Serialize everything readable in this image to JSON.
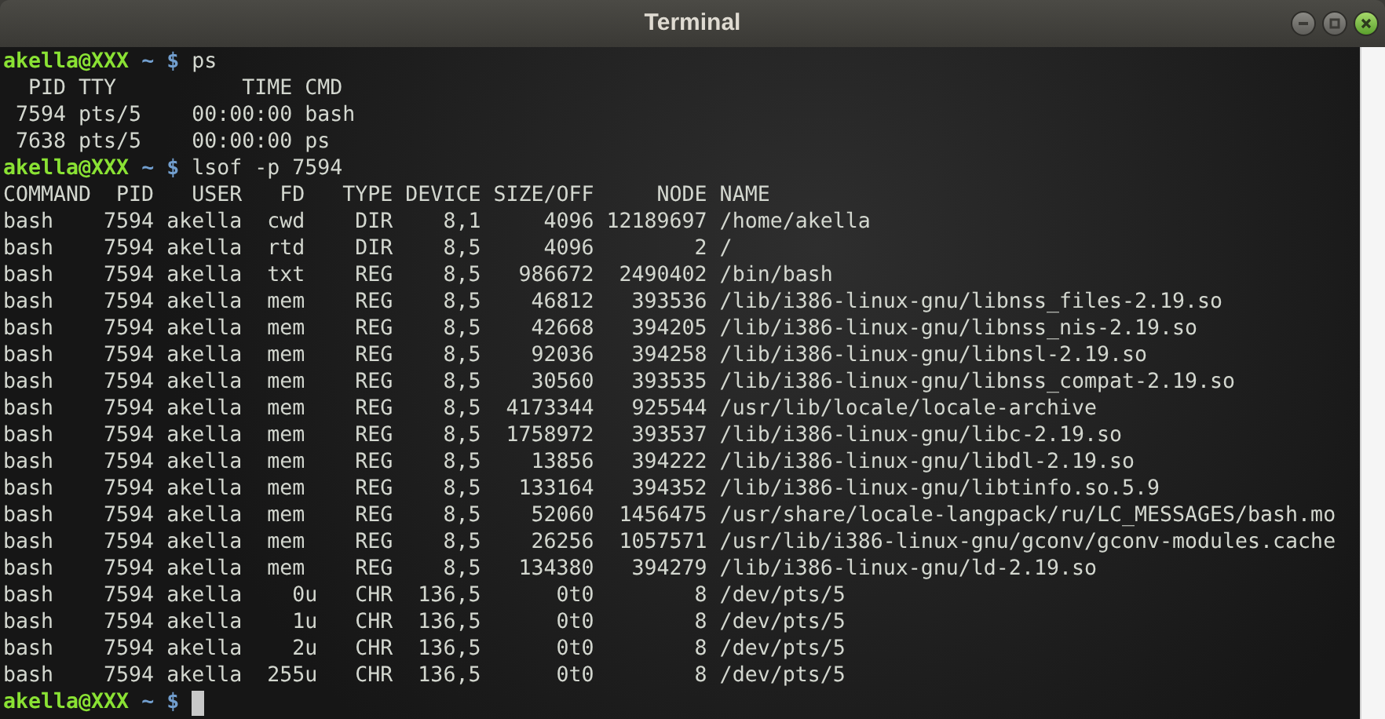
{
  "window": {
    "title": "Terminal"
  },
  "terminal": {
    "lines": [
      {
        "kind": "prompt",
        "user": "akella@XXX",
        "path": "~",
        "symbol": "$",
        "command": "ps",
        "cursor": false
      },
      {
        "kind": "output",
        "text": "  PID TTY          TIME CMD"
      },
      {
        "kind": "output",
        "text": " 7594 pts/5    00:00:00 bash"
      },
      {
        "kind": "output",
        "text": " 7638 pts/5    00:00:00 ps"
      },
      {
        "kind": "prompt",
        "user": "akella@XXX",
        "path": "~",
        "symbol": "$",
        "command": "lsof -p 7594",
        "cursor": false
      },
      {
        "kind": "output",
        "text": "COMMAND  PID   USER   FD   TYPE DEVICE SIZE/OFF     NODE NAME"
      },
      {
        "kind": "output",
        "text": "bash    7594 akella  cwd    DIR    8,1     4096 12189697 /home/akella"
      },
      {
        "kind": "output",
        "text": "bash    7594 akella  rtd    DIR    8,5     4096        2 /"
      },
      {
        "kind": "output",
        "text": "bash    7594 akella  txt    REG    8,5   986672  2490402 /bin/bash"
      },
      {
        "kind": "output",
        "text": "bash    7594 akella  mem    REG    8,5    46812   393536 /lib/i386-linux-gnu/libnss_files-2.19.so"
      },
      {
        "kind": "output",
        "text": "bash    7594 akella  mem    REG    8,5    42668   394205 /lib/i386-linux-gnu/libnss_nis-2.19.so"
      },
      {
        "kind": "output",
        "text": "bash    7594 akella  mem    REG    8,5    92036   394258 /lib/i386-linux-gnu/libnsl-2.19.so"
      },
      {
        "kind": "output",
        "text": "bash    7594 akella  mem    REG    8,5    30560   393535 /lib/i386-linux-gnu/libnss_compat-2.19.so"
      },
      {
        "kind": "output",
        "text": "bash    7594 akella  mem    REG    8,5  4173344   925544 /usr/lib/locale/locale-archive"
      },
      {
        "kind": "output",
        "text": "bash    7594 akella  mem    REG    8,5  1758972   393537 /lib/i386-linux-gnu/libc-2.19.so"
      },
      {
        "kind": "output",
        "text": "bash    7594 akella  mem    REG    8,5    13856   394222 /lib/i386-linux-gnu/libdl-2.19.so"
      },
      {
        "kind": "output",
        "text": "bash    7594 akella  mem    REG    8,5   133164   394352 /lib/i386-linux-gnu/libtinfo.so.5.9"
      },
      {
        "kind": "output",
        "text": "bash    7594 akella  mem    REG    8,5    52060  1456475 /usr/share/locale-langpack/ru/LC_MESSAGES/bash.mo"
      },
      {
        "kind": "output",
        "text": "bash    7594 akella  mem    REG    8,5    26256  1057571 /usr/lib/i386-linux-gnu/gconv/gconv-modules.cache"
      },
      {
        "kind": "output",
        "text": "bash    7594 akella  mem    REG    8,5   134380   394279 /lib/i386-linux-gnu/ld-2.19.so"
      },
      {
        "kind": "output",
        "text": "bash    7594 akella    0u   CHR  136,5      0t0        8 /dev/pts/5"
      },
      {
        "kind": "output",
        "text": "bash    7594 akella    1u   CHR  136,5      0t0        8 /dev/pts/5"
      },
      {
        "kind": "output",
        "text": "bash    7594 akella    2u   CHR  136,5      0t0        8 /dev/pts/5"
      },
      {
        "kind": "output",
        "text": "bash    7594 akella  255u   CHR  136,5      0t0        8 /dev/pts/5"
      },
      {
        "kind": "prompt",
        "user": "akella@XXX",
        "path": "~",
        "symbol": "$",
        "cursor": true
      }
    ]
  }
}
